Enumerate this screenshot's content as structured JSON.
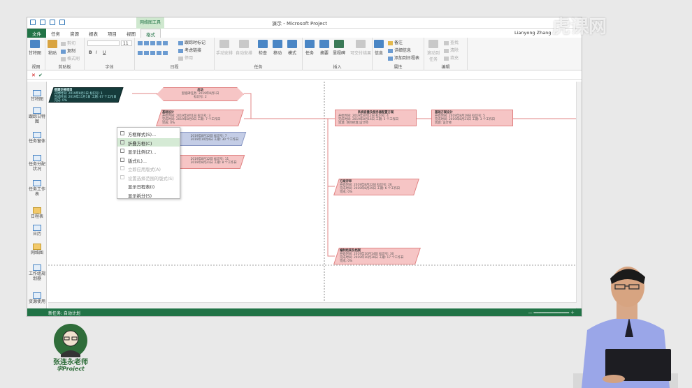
{
  "window": {
    "title": "演示 - Microsoft Project",
    "context_tab": "网络图工具",
    "user": "Lianyong Zhang"
  },
  "tabs": [
    "文件",
    "任务",
    "资源",
    "报表",
    "项目",
    "视图",
    "格式"
  ],
  "ribbon": {
    "view": {
      "label": "视图",
      "gantt": "甘特图"
    },
    "clipboard": {
      "label": "剪贴板",
      "paste": "粘贴",
      "cut": "剪切",
      "copy": "复制",
      "format_painter": "格式刷"
    },
    "font": {
      "label": "字体",
      "size": "11"
    },
    "schedule": {
      "label": "日程",
      "mark_on_track": "跟踪时标记",
      "respect_links": "考虑链接",
      "inactivate": "停用"
    },
    "tasks": {
      "label": "任务",
      "manual": "手动安排",
      "auto": "自动安排",
      "inspect": "检查",
      "move": "移动",
      "mode": "模式"
    },
    "insert": {
      "label": "插入",
      "task": "任务",
      "summary": "摘要",
      "milestone": "里程碑",
      "deliverable": "可交付结果"
    },
    "properties": {
      "label": "属性",
      "info": "信息",
      "notes": "备注",
      "details": "详细信息",
      "add_timeline": "添加到日程表"
    },
    "editing": {
      "label": "编辑",
      "scroll_to_task": "滚动到任务",
      "find": "查找",
      "clear": "清除",
      "fill": "填充"
    }
  },
  "views": [
    "甘特图",
    "跟踪甘特图",
    "任务窗体",
    "任务分配状况",
    "任务工作表",
    "日程表",
    "日历",
    "网络图",
    "工作组规划器",
    "资源使用"
  ],
  "network": {
    "summary": {
      "title": "搭建交换项目",
      "l1": "开始时间: 2019年8月1日 标识号: 1",
      "l2": "完成时间: 2019年11月1日 工期: 67 个工作日",
      "l3": "完成: 0%"
    },
    "start": {
      "title": "启动",
      "l1": "里程碑任务: 2019年8月1日",
      "l2": "标识号: 2"
    },
    "n1": {
      "title": "基础设计",
      "l1": "开始时间: 2019年8月1日 标识号: 3",
      "l2": "完成时间: 2019年8月9日 工期: 7 个工作日",
      "l3": "完成: 0%"
    },
    "n2": {
      "l1": "2019年8月12日 标识号: 7",
      "l2": "2019年10月4日 工期: 30 个工作日"
    },
    "n3": {
      "l1": "2019年8月12日 标识号: 11",
      "l2": "2019年8月21日 工期: 8 个工作日"
    },
    "n4": {
      "title": "系统容量及服务器配置方案",
      "l1": "开始时间: 2019年8月12日 标识号: 4",
      "l2": "完成时间: 2019年8月16日 工期: 5 个工作日",
      "l3": "资源: 项目经理,设计师"
    },
    "n5": {
      "title": "基础方案设计",
      "l1": "开始时间: 2019年8月19日 标识号: 5",
      "l2": "完成时间: 2019年8月21日 工期: 3 个工作日",
      "l3": "资源: 设计师"
    },
    "n6": {
      "title": "方案评审",
      "l1": "开始时间: 2019年8月22日 标识号: 26",
      "l2": "完成时间: 2019年8月29日 工期: 6 个工作日",
      "l3": "完成: 0%"
    },
    "n7": {
      "title": "编制结果及档案",
      "l1": "开始时间: 2019年10月14日 标识号: 30",
      "l2": "完成时间: 2019年10月30日 工期: 17 个工作日",
      "l3": "完成: 0%"
    }
  },
  "context_menu": [
    {
      "label": "方框样式(S)...",
      "enabled": true
    },
    {
      "label": "折叠方框(C)",
      "enabled": true
    },
    {
      "label": "显示比例(Z)...",
      "enabled": true
    },
    {
      "label": "版式(L)...",
      "enabled": true
    },
    {
      "label": "立即应用版式(A)",
      "enabled": false
    },
    {
      "label": "设置选择范围的版式(S)",
      "enabled": false
    },
    {
      "label": "显示日程表(I)",
      "enabled": true
    },
    {
      "label": "显示拆分(S)",
      "enabled": true
    }
  ],
  "status": {
    "new_task": "新任务: 自动计划"
  },
  "logo": {
    "line1": "张连永老师",
    "line2": "学Project"
  },
  "watermark": "虎课网",
  "colors": {
    "accent": "#217346",
    "task_node": "#f6c5c5",
    "summary_node": "#153b3b"
  }
}
